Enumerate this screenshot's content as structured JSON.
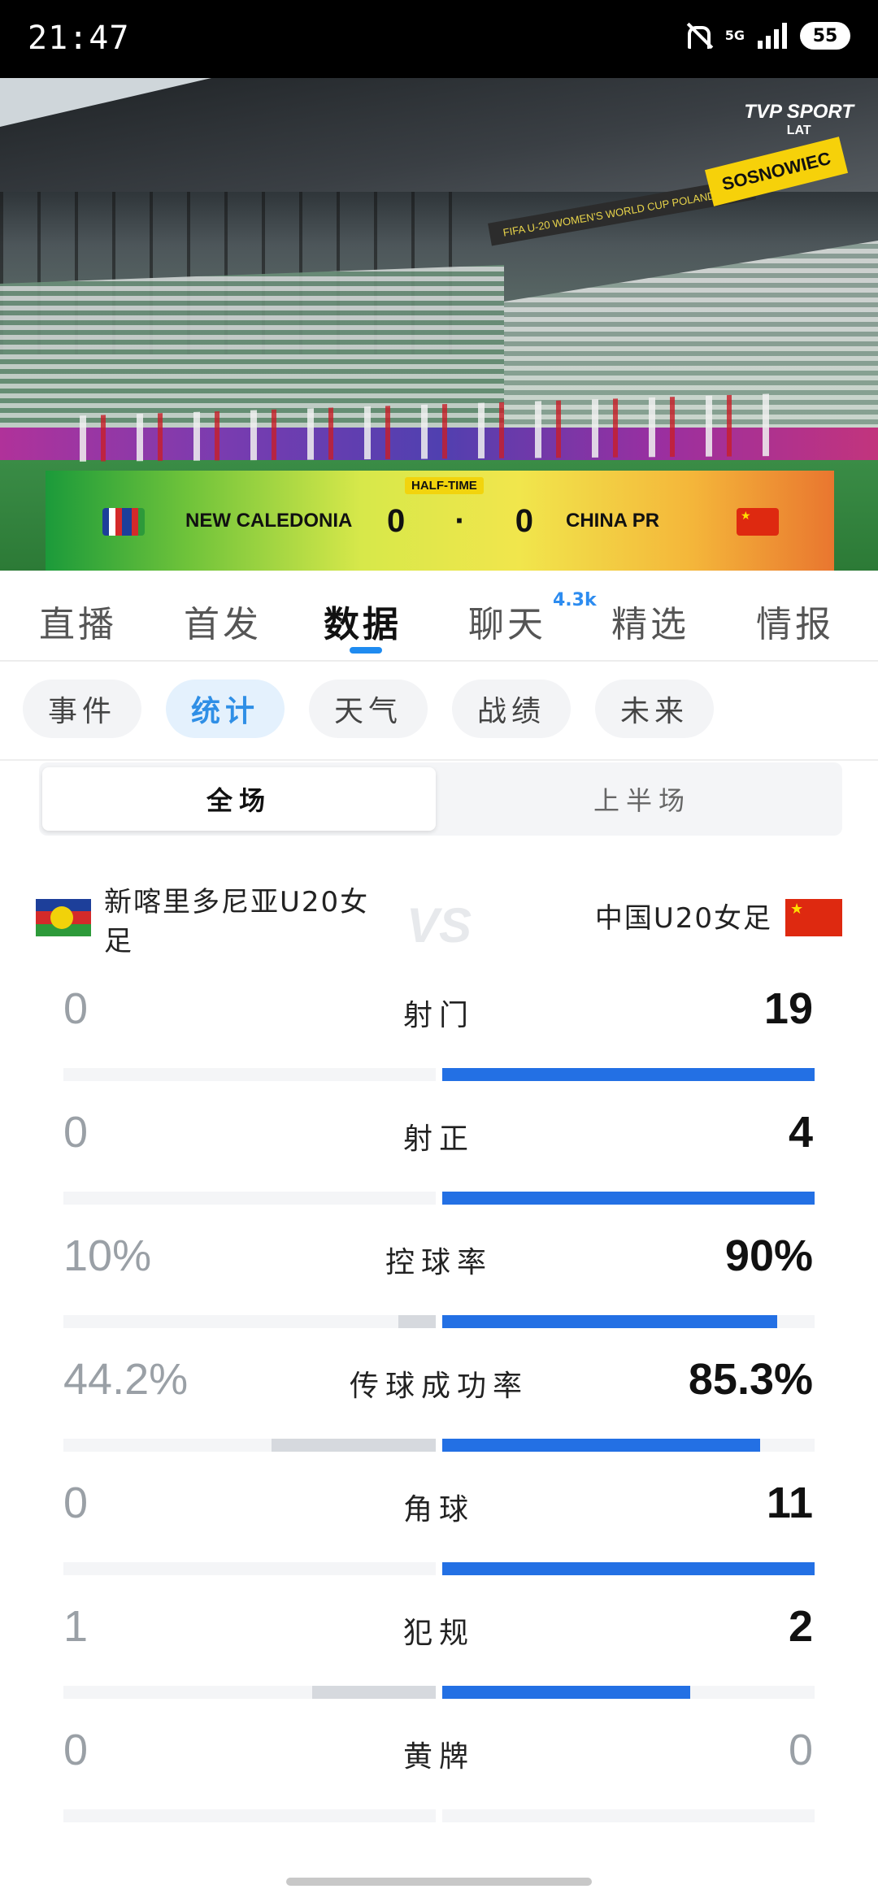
{
  "status_bar": {
    "time": "21:47",
    "network": "5G",
    "battery": "55"
  },
  "video": {
    "broadcaster_line1": "TVP SPORT",
    "broadcaster_line2": "LAT",
    "sign_text": "SOSNOWIEC",
    "banner_text": "FIFA U-20 WOMEN'S WORLD CUP POLAND 2026",
    "period_label": "HALF-TIME",
    "home_team": "NEW CALEDONIA",
    "away_team": "CHINA PR",
    "home_score": "0",
    "score_sep": "·",
    "away_score": "0"
  },
  "tabs": [
    {
      "label": "直播"
    },
    {
      "label": "首发"
    },
    {
      "label": "数据",
      "active": true
    },
    {
      "label": "聊天",
      "badge": "4.3k"
    },
    {
      "label": "精选"
    },
    {
      "label": "情报"
    }
  ],
  "sub_tabs": [
    {
      "label": "事件"
    },
    {
      "label": "统计",
      "active": true
    },
    {
      "label": "天气"
    },
    {
      "label": "战绩"
    },
    {
      "label": "未来"
    }
  ],
  "period_toggle": {
    "full": "全场",
    "first_half": "上半场"
  },
  "teams": {
    "home": "新喀里多尼亚U20女足",
    "away": "中国U20女足",
    "vs": "VS"
  },
  "stats": [
    {
      "label": "射门",
      "home": "0",
      "away": "19",
      "home_share": 0,
      "away_share": 1.0
    },
    {
      "label": "射正",
      "home": "0",
      "away": "4",
      "home_share": 0,
      "away_share": 1.0
    },
    {
      "label": "控球率",
      "home": "10%",
      "away": "90%",
      "home_share": 0.1,
      "away_share": 0.9
    },
    {
      "label": "传球成功率",
      "home": "44.2%",
      "away": "85.3%",
      "home_share": 0.442,
      "away_share": 0.853
    },
    {
      "label": "角球",
      "home": "0",
      "away": "11",
      "home_share": 0,
      "away_share": 1.0
    },
    {
      "label": "犯规",
      "home": "1",
      "away": "2",
      "home_share": 0.333,
      "away_share": 0.667
    },
    {
      "label": "黄牌",
      "home": "0",
      "away": "0",
      "home_share": 0,
      "away_share": 0
    }
  ],
  "colors": {
    "accent": "#2370e4",
    "home_bar": "#d6d9de",
    "chip_active": "#2f8fe6"
  }
}
